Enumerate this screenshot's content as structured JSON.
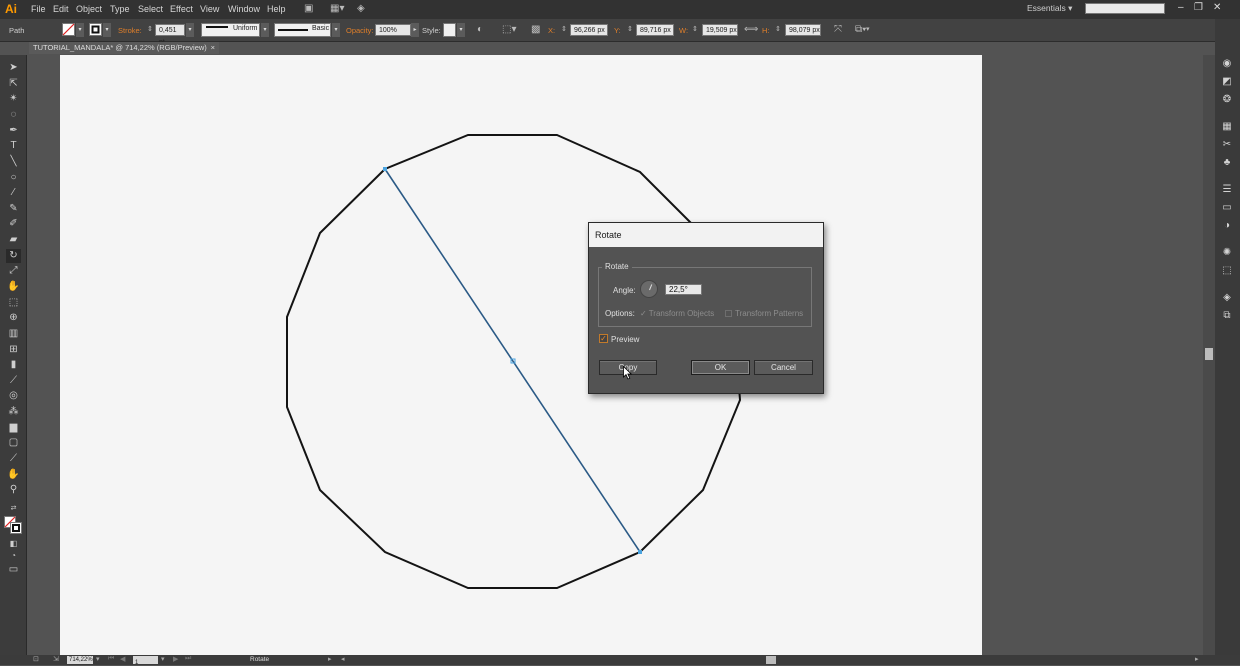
{
  "app": {
    "logo": "Ai"
  },
  "menu": [
    "File",
    "Edit",
    "Object",
    "Type",
    "Select",
    "Effect",
    "View",
    "Window",
    "Help"
  ],
  "workspace": {
    "label": "Essentials"
  },
  "search": {
    "value": ""
  },
  "control_bar": {
    "selection_type": "Path",
    "stroke_label": "Stroke:",
    "stroke_weight": "0,451 pt",
    "profile_uniform": "Uniform",
    "brush_basic": "Basic",
    "opacity_label": "Opacity:",
    "opacity_value": "100%",
    "style_label": "Style:",
    "x_label": "X:",
    "x_value": "96,266 px",
    "y_label": "Y:",
    "y_value": "89,716 px",
    "w_label": "W:",
    "w_value": "19,509 px",
    "h_label": "H:",
    "h_value": "98,079 px"
  },
  "document_tab": {
    "title": "TUTORIAL_MANDALA* @ 714,22% (RGB/Preview)",
    "close": "×"
  },
  "status_bar": {
    "zoom": "714,22%",
    "page": "1",
    "status": "Rotate"
  },
  "dialog": {
    "title": "Rotate",
    "group_label": "Rotate",
    "angle_label": "Angle:",
    "angle_value": "22,5°",
    "options_label": "Options:",
    "transform_objects": "Transform Objects",
    "transform_patterns": "Transform Patterns",
    "preview_label": "Preview",
    "preview_checked": true,
    "copy_label": "Copy",
    "ok_label": "OK",
    "cancel_label": "Cancel"
  },
  "icons": {
    "tools": [
      "selection-tool-icon",
      "direct-selection-tool-icon",
      "magic-wand-tool-icon",
      "lasso-tool-icon",
      "pen-tool-icon",
      "type-tool-icon",
      "line-segment-tool-icon",
      "ellipse-tool-icon",
      "paintbrush-tool-icon",
      "pencil-tool-icon",
      "blob-brush-tool-icon",
      "eraser-tool-icon",
      "rotate-tool-icon",
      "scale-tool-icon",
      "warp-tool-icon",
      "free-transform-tool-icon",
      "shape-builder-tool-icon",
      "perspective-grid-tool-icon",
      "mesh-tool-icon",
      "gradient-tool-icon",
      "eyedropper-tool-icon",
      "blend-tool-icon",
      "symbol-sprayer-tool-icon",
      "column-graph-tool-icon",
      "artboard-tool-icon",
      "slice-tool-icon",
      "hand-tool-icon",
      "zoom-tool-icon",
      "swap-fill-stroke-icon",
      "fill-stroke-icon",
      "color-mode-icon",
      "draw-mode-icon",
      "screen-mode-icon"
    ],
    "panels": [
      "color-panel-icon",
      "color-guide-panel-icon",
      "appearance-panel-icon",
      "swatches-panel-icon",
      "symbols-panel-icon",
      "stroke-panel-icon",
      "gradient-panel-icon",
      "transparency-panel-icon",
      "brushes-panel-icon",
      "graphic-styles-panel-icon",
      "transform-panel-icon",
      "layers-panel-icon",
      "artboards-panel-icon"
    ]
  }
}
